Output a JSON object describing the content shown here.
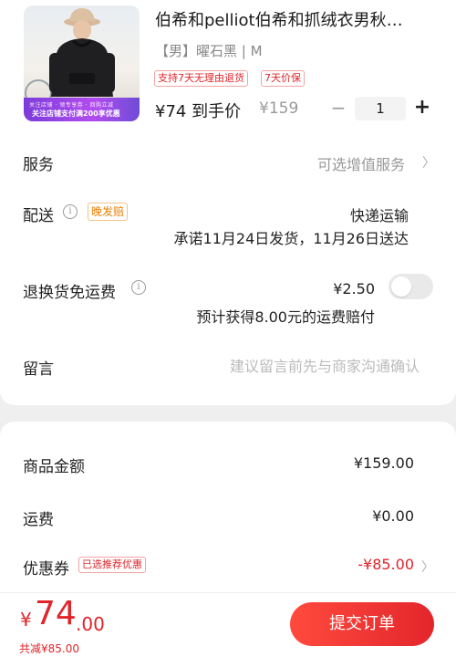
{
  "product": {
    "title": "伯希和pelliot伯希和抓绒衣男秋…",
    "sku": "【男】曜石黑 | M",
    "banner_top": "关注店铺 · 领专享券 · 回购立减",
    "banner_main": "关注店铺支付满200享优惠",
    "tags": [
      "支持7天无理由退货",
      "7天价保"
    ],
    "price_now": "¥74 到手价",
    "price_original": "¥159",
    "quantity": "1",
    "minus": "−",
    "plus": "+"
  },
  "service": {
    "label": "服务",
    "value": "可选增值服务"
  },
  "delivery": {
    "label": "配送",
    "late_tag": "晚发赔",
    "method": "快递运输",
    "promise": "承诺11月24日发货，11月26日送达"
  },
  "return_shipping": {
    "label": "退换货免运费",
    "price": "¥2.50",
    "note": "预计获得8.00元的运费赔付",
    "enabled": false
  },
  "message": {
    "label": "留言",
    "placeholder": "建议留言前先与商家沟通确认"
  },
  "summary": {
    "goods_label": "商品金额",
    "goods_value": "¥159.00",
    "shipping_label": "运费",
    "shipping_value": "¥0.00",
    "coupon_label": "优惠券",
    "coupon_tag": "已选推荐优惠",
    "coupon_value": "-¥85.00"
  },
  "footer": {
    "currency": "¥",
    "total_int": "74",
    "total_dec": ".00",
    "saved": "共减¥85.00",
    "submit": "提交订单"
  },
  "icons": {
    "chevron": "chevron-right-icon",
    "info": "info-circle-icon"
  }
}
